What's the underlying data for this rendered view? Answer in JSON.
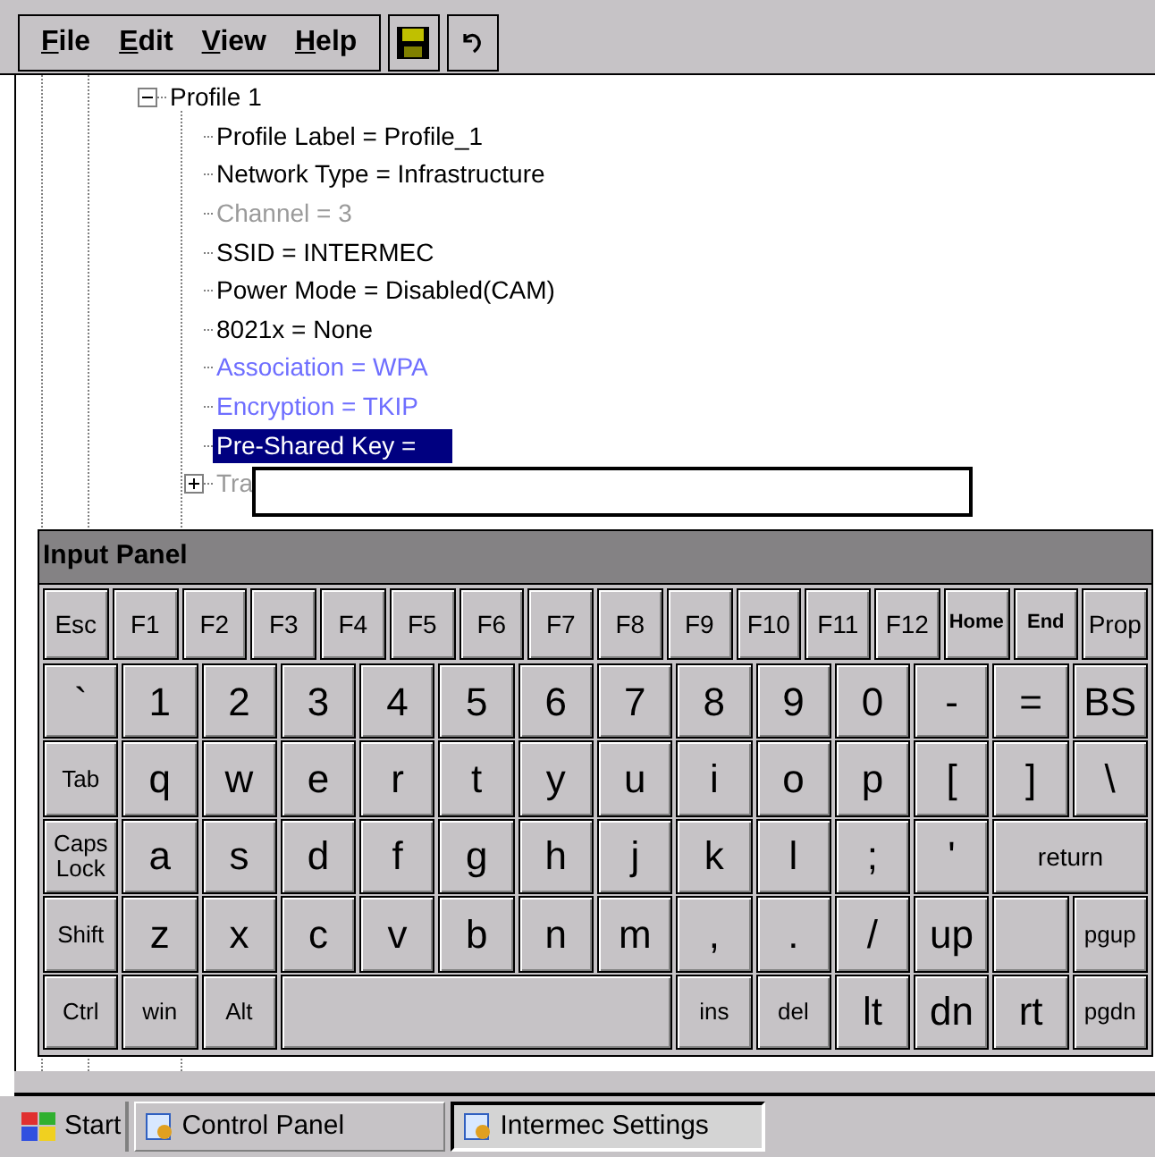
{
  "menu": [
    "File",
    "Edit",
    "View",
    "Help"
  ],
  "tree": [
    {
      "text": "Profile 1",
      "kind": "plain",
      "selected": false,
      "expanded": true,
      "children": [
        {
          "text": "Profile Label = Profile_1",
          "kind": "plain",
          "selected": false
        },
        {
          "text": "Network Type = Infrastructure",
          "kind": "plain",
          "selected": false
        },
        {
          "text": "Channel = 3",
          "kind": "disabled",
          "selected": false
        },
        {
          "text": "SSID = INTERMEC",
          "kind": "plain",
          "selected": false
        },
        {
          "text": "Power Mode = Disabled(CAM)",
          "kind": "plain",
          "selected": false
        },
        {
          "text": "8021x = None",
          "kind": "plain",
          "selected": false
        },
        {
          "text": "Association = WPA",
          "kind": "accent",
          "selected": false
        },
        {
          "text": "Encryption = TKIP",
          "kind": "accent",
          "selected": false
        },
        {
          "text": "Pre-Shared Key =",
          "kind": "plain",
          "selected": true
        },
        {
          "text": "Tra",
          "kind": "disabled",
          "selected": false,
          "expanded": false
        }
      ]
    }
  ],
  "input_panel": {
    "title": "Input Panel",
    "function_keys": [
      {
        "label": "Esc",
        "kind": "fn"
      },
      {
        "label": "F1",
        "kind": "fn"
      },
      {
        "label": "F2",
        "kind": "fn"
      },
      {
        "label": "F3",
        "kind": "fn"
      },
      {
        "label": "F4",
        "kind": "fn"
      },
      {
        "label": "F5",
        "kind": "fn"
      },
      {
        "label": "F6",
        "kind": "fn"
      },
      {
        "label": "F7",
        "kind": "fn"
      },
      {
        "label": "F8",
        "kind": "fn"
      },
      {
        "label": "F9",
        "kind": "fn"
      },
      {
        "label": "F10",
        "kind": "fn"
      },
      {
        "label": "F11",
        "kind": "fn"
      },
      {
        "label": "F12",
        "kind": "fn"
      },
      {
        "label": "Home",
        "kind": "tiny"
      },
      {
        "label": "End",
        "kind": "tiny"
      },
      {
        "label": "Prop",
        "kind": "fn"
      }
    ],
    "rows": [
      [
        {
          "label": "`",
          "kind": "char"
        },
        {
          "label": "1",
          "kind": "char"
        },
        {
          "label": "2",
          "kind": "char"
        },
        {
          "label": "3",
          "kind": "char"
        },
        {
          "label": "4",
          "kind": "char"
        },
        {
          "label": "5",
          "kind": "char"
        },
        {
          "label": "6",
          "kind": "char"
        },
        {
          "label": "7",
          "kind": "char"
        },
        {
          "label": "8",
          "kind": "char"
        },
        {
          "label": "9",
          "kind": "char"
        },
        {
          "label": "0",
          "kind": "char"
        },
        {
          "label": "-",
          "kind": "char"
        },
        {
          "label": "=",
          "kind": "char"
        },
        {
          "label": "BS",
          "kind": "char"
        }
      ],
      [
        {
          "label": "Tab",
          "kind": "mod"
        },
        {
          "label": "q",
          "kind": "char"
        },
        {
          "label": "w",
          "kind": "char"
        },
        {
          "label": "e",
          "kind": "char"
        },
        {
          "label": "r",
          "kind": "char"
        },
        {
          "label": "t",
          "kind": "char"
        },
        {
          "label": "y",
          "kind": "char"
        },
        {
          "label": "u",
          "kind": "char"
        },
        {
          "label": "i",
          "kind": "char"
        },
        {
          "label": "o",
          "kind": "char"
        },
        {
          "label": "p",
          "kind": "char"
        },
        {
          "label": "[",
          "kind": "char"
        },
        {
          "label": "]",
          "kind": "char"
        },
        {
          "label": "\\",
          "kind": "char"
        }
      ],
      [
        {
          "label": "Caps Lock",
          "kind": "mod"
        },
        {
          "label": "a",
          "kind": "char"
        },
        {
          "label": "s",
          "kind": "char"
        },
        {
          "label": "d",
          "kind": "char"
        },
        {
          "label": "f",
          "kind": "char"
        },
        {
          "label": "g",
          "kind": "char"
        },
        {
          "label": "h",
          "kind": "char"
        },
        {
          "label": "j",
          "kind": "char"
        },
        {
          "label": "k",
          "kind": "char"
        },
        {
          "label": "l",
          "kind": "char"
        },
        {
          "label": ";",
          "kind": "char"
        },
        {
          "label": "'",
          "kind": "char"
        },
        {
          "label": "return",
          "kind": "wide"
        }
      ],
      [
        {
          "label": "Shift",
          "kind": "mod"
        },
        {
          "label": "z",
          "kind": "char"
        },
        {
          "label": "x",
          "kind": "char"
        },
        {
          "label": "c",
          "kind": "char"
        },
        {
          "label": "v",
          "kind": "char"
        },
        {
          "label": "b",
          "kind": "char"
        },
        {
          "label": "n",
          "kind": "char"
        },
        {
          "label": "m",
          "kind": "char"
        },
        {
          "label": ",",
          "kind": "char"
        },
        {
          "label": ".",
          "kind": "char"
        },
        {
          "label": "/",
          "kind": "char"
        },
        {
          "label": "up",
          "kind": "char"
        },
        {
          "kind": "blank"
        },
        {
          "label": "pgup",
          "kind": "mod"
        }
      ]
    ],
    "bottom_keys": [
      {
        "label": "Ctrl",
        "kind": "mod"
      },
      {
        "label": "win",
        "kind": "mod"
      },
      {
        "label": "Alt",
        "kind": "mod"
      },
      {
        "kind": "space"
      },
      {
        "label": "ins",
        "kind": "mod"
      },
      {
        "label": "del",
        "kind": "mod"
      },
      {
        "label": "lt",
        "kind": "char"
      },
      {
        "label": "dn",
        "kind": "char"
      },
      {
        "label": "rt",
        "kind": "char"
      },
      {
        "label": "pgdn",
        "kind": "mod"
      }
    ]
  },
  "taskbar": {
    "start": "Start",
    "tasks": [
      {
        "label": "Control Panel",
        "selected": false
      },
      {
        "label": "Intermec Settings",
        "selected": true
      }
    ]
  }
}
